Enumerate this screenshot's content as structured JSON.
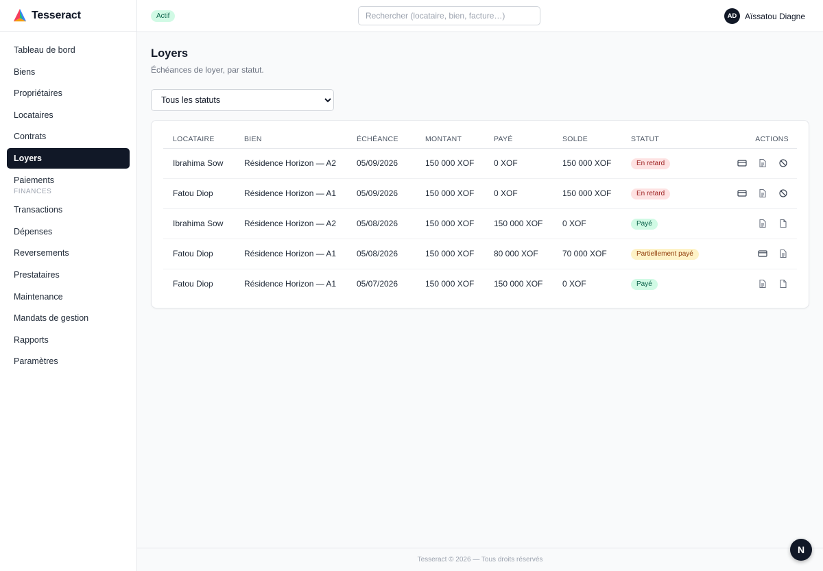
{
  "app": {
    "name": "Tesseract",
    "logo_icon": "tesseract-logo-icon"
  },
  "sidebar": {
    "items": [
      {
        "label": "Tableau de bord"
      },
      {
        "label": "Biens"
      },
      {
        "label": "Propriétaires"
      },
      {
        "label": "Locataires"
      },
      {
        "label": "Contrats"
      },
      {
        "label": "Loyers",
        "active": true
      },
      {
        "label": "Paiements"
      }
    ],
    "section_finances": "FINANCES",
    "finance_items": [
      {
        "label": "Transactions"
      },
      {
        "label": "Dépenses"
      },
      {
        "label": "Reversements"
      },
      {
        "label": "Prestataires"
      },
      {
        "label": "Maintenance"
      },
      {
        "label": "Mandats de gestion"
      },
      {
        "label": "Rapports"
      },
      {
        "label": "Paramètres"
      }
    ]
  },
  "header": {
    "status_badge": "Actif",
    "search_placeholder": "Rechercher (locataire, bien, facture…)",
    "user": {
      "initials": "AD",
      "name": "Aïssatou Diagne"
    }
  },
  "main": {
    "title": "Loyers",
    "subtitle": "Échéances de loyer, par statut.",
    "filter": {
      "selected": "Tous les statuts"
    },
    "table": {
      "columns": [
        "LOCATAIRE",
        "BIEN",
        "ÉCHÉANCE",
        "MONTANT",
        "PAYÉ",
        "SOLDE",
        "STATUT",
        "ACTIONS"
      ],
      "rows": [
        {
          "locataire": "Ibrahima Sow",
          "bien": "Résidence Horizon — A2",
          "echeance": "05/09/2026",
          "montant": "150 000 XOF",
          "paye": "0 XOF",
          "solde": "150 000 XOF",
          "statut": "En retard",
          "statut_kind": "late",
          "actions": [
            "card-icon",
            "document-icon",
            "cancel-icon"
          ]
        },
        {
          "locataire": "Fatou Diop",
          "bien": "Résidence Horizon — A1",
          "echeance": "05/09/2026",
          "montant": "150 000 XOF",
          "paye": "0 XOF",
          "solde": "150 000 XOF",
          "statut": "En retard",
          "statut_kind": "late",
          "actions": [
            "card-icon",
            "document-icon",
            "cancel-icon"
          ]
        },
        {
          "locataire": "Ibrahima Sow",
          "bien": "Résidence Horizon — A2",
          "echeance": "05/08/2026",
          "montant": "150 000 XOF",
          "paye": "150 000 XOF",
          "solde": "0 XOF",
          "statut": "Payé",
          "statut_kind": "paid",
          "actions": [
            "document-icon",
            "receipt-icon"
          ]
        },
        {
          "locataire": "Fatou Diop",
          "bien": "Résidence Horizon — A1",
          "echeance": "05/08/2026",
          "montant": "150 000 XOF",
          "paye": "80 000 XOF",
          "solde": "70 000 XOF",
          "statut": "Partiellement payé",
          "statut_kind": "partial",
          "actions": [
            "card-icon",
            "document-icon"
          ]
        },
        {
          "locataire": "Fatou Diop",
          "bien": "Résidence Horizon — A1",
          "echeance": "05/07/2026",
          "montant": "150 000 XOF",
          "paye": "150 000 XOF",
          "solde": "0 XOF",
          "statut": "Payé",
          "statut_kind": "paid",
          "actions": [
            "document-icon",
            "receipt-icon"
          ]
        }
      ]
    }
  },
  "footer": {
    "text": "Tesseract © 2026 — Tous droits réservés"
  },
  "dev_badge": {
    "label": "N"
  },
  "colors": {
    "active_nav_bg": "#111827",
    "late_bg": "#fee2e2",
    "late_fg": "#991b1b",
    "paid_bg": "#d1fae5",
    "paid_fg": "#065f46",
    "partial_bg": "#fef3c7",
    "partial_fg": "#92400e"
  }
}
